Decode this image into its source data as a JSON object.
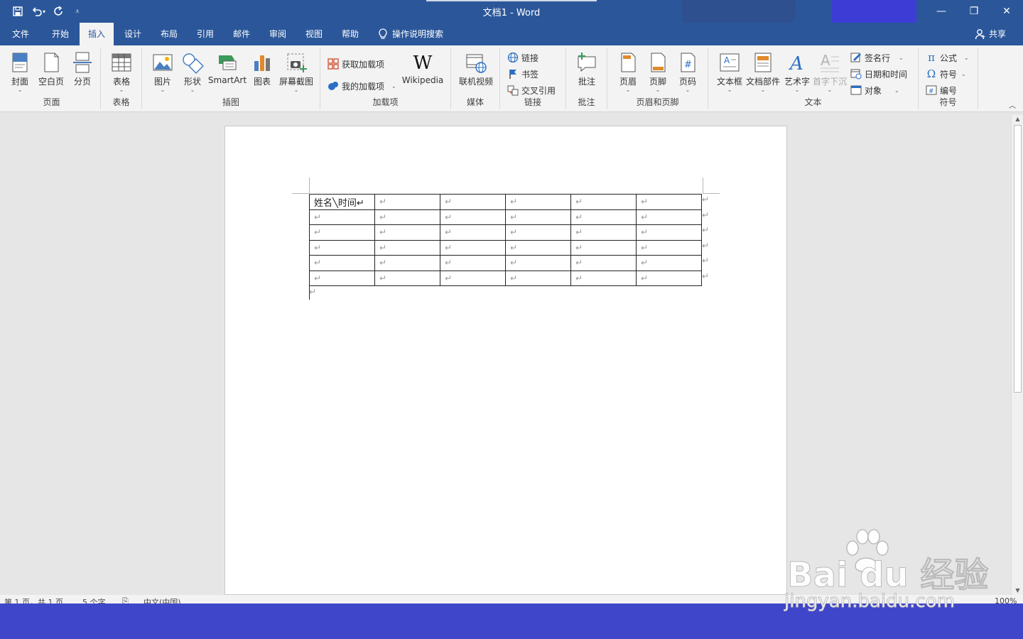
{
  "window": {
    "title": "文档1  -  Word",
    "controls": {
      "minimize": "—",
      "restore": "❐",
      "close": "✕"
    }
  },
  "menu_tabs": [
    {
      "label": "文件",
      "active": false
    },
    {
      "label": "开始",
      "active": false
    },
    {
      "label": "插入",
      "active": true
    },
    {
      "label": "设计",
      "active": false
    },
    {
      "label": "布局",
      "active": false
    },
    {
      "label": "引用",
      "active": false
    },
    {
      "label": "邮件",
      "active": false
    },
    {
      "label": "审阅",
      "active": false
    },
    {
      "label": "视图",
      "active": false
    },
    {
      "label": "帮助",
      "active": false
    }
  ],
  "tell_me": "操作说明搜索",
  "share": "共享",
  "ribbon": {
    "pages": {
      "label": "页面",
      "cover": "封面",
      "blank": "空白页",
      "break": "分页"
    },
    "tables": {
      "label": "表格",
      "table": "表格"
    },
    "illustrations": {
      "label": "插图",
      "pictures": "图片",
      "shapes": "形状",
      "smartart": "SmartArt",
      "chart": "图表",
      "screenshot": "屏幕截图"
    },
    "addins": {
      "label": "加载项",
      "get": "获取加载项",
      "mine": "我的加载项",
      "wikipedia": "Wikipedia",
      "wiki_glyph": "W"
    },
    "media": {
      "label": "媒体",
      "video": "联机视频"
    },
    "links": {
      "label": "链接",
      "link": "链接",
      "bookmark": "书签",
      "crossref": "交叉引用"
    },
    "comments": {
      "label": "批注",
      "comment": "批注"
    },
    "header_footer": {
      "label": "页眉和页脚",
      "header": "页眉",
      "footer": "页脚",
      "page_number": "页码"
    },
    "text": {
      "label": "文本",
      "textbox": "文本框",
      "quickparts": "文档部件",
      "wordart": "艺术字",
      "dropcap": "首字下沉",
      "signature": "签名行",
      "datetime": "日期和时间",
      "object": "对象"
    },
    "symbols": {
      "label": "符号",
      "equation": "公式",
      "symbol": "符号",
      "number": "编号"
    }
  },
  "document": {
    "table_header_cell": "姓名╲时间↵",
    "cell_mark": "↵",
    "rows": 6,
    "cols": 6,
    "para_mark": "↵"
  },
  "status": {
    "page": "第 1 页，共 1 页",
    "words": "5 个字",
    "lang": "中文(中国)",
    "zoom": "100%"
  },
  "watermark": {
    "brand": "Bai du 经验",
    "url": "jingyan.baidu.com"
  },
  "colors": {
    "accent": "#2b579a",
    "ribbon_bg": "#f3f3f3",
    "band": "#3f46c9"
  }
}
